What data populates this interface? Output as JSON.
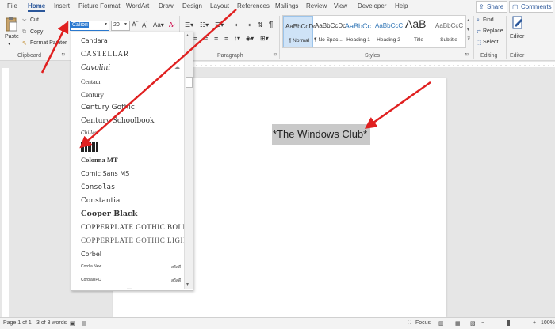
{
  "tabs": [
    "File",
    "Home",
    "Insert",
    "Picture Format",
    "WordArt",
    "Draw",
    "Design",
    "Layout",
    "References",
    "Mailings",
    "Review",
    "View",
    "Developer",
    "Help"
  ],
  "share_label": "Share",
  "comments_label": "Comments",
  "clipboard": {
    "paste": "Paste",
    "cut": "Cut",
    "copy": "Copy",
    "format_painter": "Format Painter",
    "group": "Clipboard"
  },
  "font": {
    "name": "Calibri",
    "size": "20"
  },
  "groups": {
    "paragraph": "Paragraph",
    "styles": "Styles",
    "editing": "Editing",
    "editor": "Editor"
  },
  "styles": [
    {
      "preview": "AaBbCcDc",
      "name": "¶ Normal",
      "selected": true
    },
    {
      "preview": "AaBbCcDc",
      "name": "¶ No Spac...",
      "selected": false
    },
    {
      "preview": "AaBbCc",
      "name": "Heading 1",
      "selected": false
    },
    {
      "preview": "AaBbCcC",
      "name": "Heading 2",
      "selected": false
    },
    {
      "preview": "AaB",
      "name": "Title",
      "selected": false
    },
    {
      "preview": "AaBbCcC",
      "name": "Subtitle",
      "selected": false
    }
  ],
  "editing": {
    "find": "Find",
    "replace": "Replace",
    "select": "Select"
  },
  "editor_label": "Editor",
  "fonts": [
    "Candara",
    "CASTELLAR",
    "Cavolini",
    "Centaur",
    "Century",
    "Century Gothic",
    "Century Schoolbook",
    "Chiller",
    "",
    "Colonna MT",
    "Comic Sans MS",
    "Consolas",
    "Constantia",
    "Cooper Black",
    "COPPERPLATE GOTHIC BOLD",
    "COPPERPLATE GOTHIC LIGHT",
    "Corbel",
    "Cordia New",
    "CordiaUPC"
  ],
  "thai_sample": "สวัสดี",
  "document_text": "*The Windows Club*",
  "status": {
    "page": "Page 1 of 1",
    "words": "3 of 3 words",
    "focus": "Focus",
    "zoom": "100%"
  },
  "colors": {
    "accent": "#2b579a",
    "arrow": "#e02020"
  }
}
